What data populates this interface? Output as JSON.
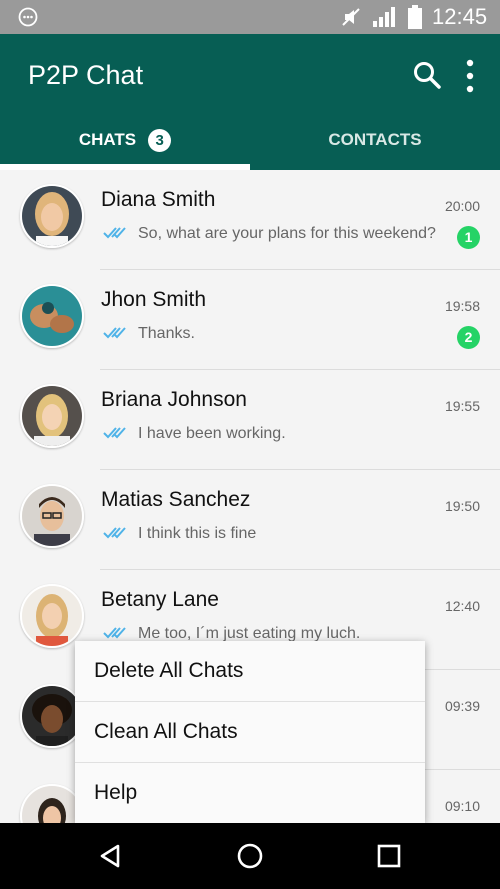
{
  "status_bar": {
    "time": "12:45",
    "icons": [
      "notification-icon",
      "mute-icon",
      "signal-icon",
      "battery-icon"
    ]
  },
  "app_bar": {
    "title": "P2P Chat",
    "icons": [
      "search-icon",
      "more-vert-icon"
    ],
    "color": "#075e54"
  },
  "tabs": [
    {
      "label": "CHATS",
      "badge": "3",
      "selected": true
    },
    {
      "label": "CONTACTS",
      "selected": false
    }
  ],
  "chats": [
    {
      "name": "Diana Smith",
      "time": "20:00",
      "message": "So, what are your plans for this weekend?",
      "unread": "1"
    },
    {
      "name": "Jhon Smith",
      "time": "19:58",
      "message": "Thanks.",
      "unread": "2"
    },
    {
      "name": "Briana Johnson",
      "time": "19:55",
      "message": "I have been working.",
      "unread": ""
    },
    {
      "name": "Matias Sanchez",
      "time": "19:50",
      "message": "I think this is fine",
      "unread": ""
    },
    {
      "name": "Betany Lane",
      "time": "12:40",
      "message": "Me too, I´m just eating my luch.",
      "unread": ""
    },
    {
      "name": "",
      "time": "09:39",
      "message": "",
      "unread": ""
    },
    {
      "name": "",
      "time": "09:10",
      "message": "",
      "unread": ""
    }
  ],
  "menu": {
    "items": [
      "Delete All Chats",
      "Clean All Chats",
      "Help"
    ]
  },
  "nav_bar": {
    "icons": [
      "back-icon",
      "home-icon",
      "recents-icon"
    ]
  },
  "colors": {
    "primary": "#075e54",
    "accent_green": "#25d366",
    "tick_blue": "#4fb3e8"
  }
}
